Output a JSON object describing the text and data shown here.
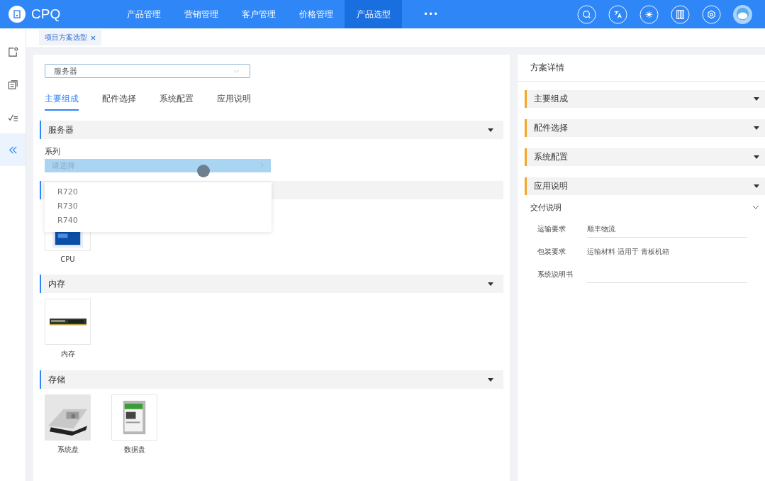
{
  "app": {
    "logo_text": "CPQ"
  },
  "nav": [
    {
      "label": "产品管理",
      "selected": false
    },
    {
      "label": "营销管理",
      "selected": false
    },
    {
      "label": "客户管理",
      "selected": false
    },
    {
      "label": "价格管理",
      "selected": false
    },
    {
      "label": "产品选型",
      "selected": true
    },
    {
      "label": "•••",
      "selected": false
    }
  ],
  "header_icons": [
    {
      "kind": "search"
    },
    {
      "kind": "translate"
    },
    {
      "kind": "theme"
    },
    {
      "kind": "columns"
    },
    {
      "kind": "settings"
    },
    {
      "kind": "avatar"
    }
  ],
  "sidebar": [
    {
      "kind": "edit",
      "selected": false
    },
    {
      "kind": "copy",
      "selected": false
    },
    {
      "kind": "checklist",
      "selected": false
    },
    {
      "kind": "collapse",
      "selected": true
    }
  ],
  "page_tabs": [
    {
      "label": "项目方案选型",
      "closable": true
    }
  ],
  "main": {
    "product_select": {
      "value": "服务器"
    },
    "tabs": [
      {
        "label": "主要组成",
        "selected": true
      },
      {
        "label": "配件选择",
        "selected": false
      },
      {
        "label": "系统配置",
        "selected": false
      },
      {
        "label": "应用说明",
        "selected": false
      }
    ],
    "sections": [
      {
        "title": "服务器",
        "field": {
          "label": "系列",
          "placeholder": "请选择"
        }
      },
      {
        "items": [
          {
            "label": "CPU",
            "kind": "cpu"
          }
        ]
      },
      {
        "title": "内存",
        "items": [
          {
            "label": "内存",
            "kind": "ram"
          }
        ]
      },
      {
        "title": "存储",
        "items": [
          {
            "label": "系统盘",
            "kind": "tray"
          },
          {
            "label": "数据盘",
            "kind": "hdd"
          }
        ]
      }
    ],
    "dropdown": {
      "options": [
        "R720",
        "R730",
        "R740"
      ]
    }
  },
  "details": {
    "title": "方案详情",
    "groups": [
      {
        "title": "主要组成"
      },
      {
        "title": "配件选择"
      },
      {
        "title": "系统配置"
      },
      {
        "title": "应用说明"
      }
    ],
    "delivery": {
      "title": "交付说明",
      "expanded": true,
      "fields": [
        {
          "label": "运输要求",
          "value": "顺丰物流"
        },
        {
          "label": "包装要求",
          "value": "运输材料 适用于 青板机箱"
        },
        {
          "label": "系统说明书"
        }
      ]
    }
  }
}
